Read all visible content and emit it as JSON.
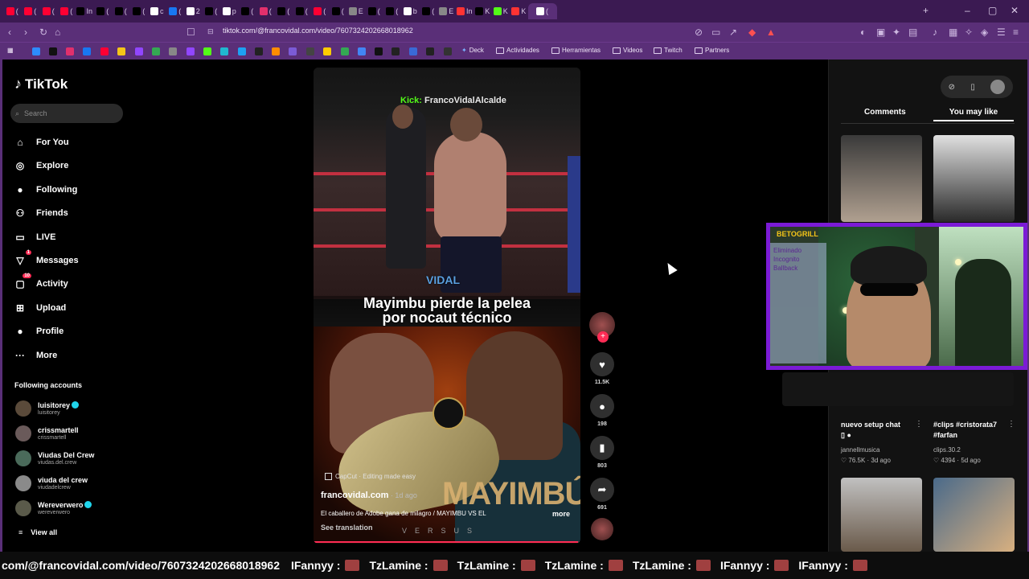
{
  "browser": {
    "tabs": [
      {
        "icon": "youtube-icon",
        "color": "#ff0033",
        "text": "("
      },
      {
        "icon": "youtube-icon",
        "color": "#ff0033",
        "text": "("
      },
      {
        "icon": "youtube-icon",
        "color": "#ff0033",
        "text": "("
      },
      {
        "icon": "youtube-icon",
        "color": "#ff0033",
        "text": "("
      },
      {
        "icon": "x-icon",
        "color": "#000000",
        "text": "In"
      },
      {
        "icon": "x-icon",
        "color": "#000000",
        "text": "("
      },
      {
        "icon": "x-icon",
        "color": "#000000",
        "text": "("
      },
      {
        "icon": "x-icon",
        "color": "#000000",
        "text": "("
      },
      {
        "icon": "generic-icon",
        "color": "#ffffff",
        "text": "c"
      },
      {
        "icon": "facebook-icon",
        "color": "#1877f2",
        "text": "("
      },
      {
        "icon": "generic-icon",
        "color": "#ffffff",
        "text": "2"
      },
      {
        "icon": "tiktok-icon",
        "color": "#000000",
        "text": "("
      },
      {
        "icon": "generic-icon",
        "color": "#ffffff",
        "text": "p"
      },
      {
        "icon": "tiktok-icon",
        "color": "#000000",
        "text": "("
      },
      {
        "icon": "instagram-icon",
        "color": "#e1306c",
        "text": "("
      },
      {
        "icon": "tiktok-icon",
        "color": "#000000",
        "text": "("
      },
      {
        "icon": "tiktok-icon",
        "color": "#000000",
        "text": "("
      },
      {
        "icon": "youtube-icon",
        "color": "#ff0033",
        "text": "("
      },
      {
        "icon": "tiktok-icon",
        "color": "#000000",
        "text": "("
      },
      {
        "icon": "generic-icon",
        "color": "#888888",
        "text": "E"
      },
      {
        "icon": "tiktok-icon",
        "color": "#000000",
        "text": "("
      },
      {
        "icon": "tiktok-icon",
        "color": "#000000",
        "text": "("
      },
      {
        "icon": "generic-icon",
        "color": "#ffffff",
        "text": "b"
      },
      {
        "icon": "tiktok-icon",
        "color": "#000000",
        "text": "("
      },
      {
        "icon": "generic-icon",
        "color": "#888888",
        "text": "E"
      },
      {
        "icon": "generic-icon",
        "color": "#ff3333",
        "text": "In"
      },
      {
        "icon": "tiktok-icon",
        "color": "#000000",
        "text": "K"
      },
      {
        "icon": "kick-icon",
        "color": "#53fc18",
        "text": "K"
      },
      {
        "icon": "generic-icon",
        "color": "#ff3333",
        "text": "K"
      },
      {
        "icon": "generic-icon",
        "color": "#ffffff",
        "text": "("
      }
    ],
    "url": "tiktok.com/@francovidal.com/video/7607324202668018962",
    "bookmarks": {
      "deck": "Deck",
      "folders": [
        "Actividades",
        "Herramientas",
        "Videos",
        "Twitch",
        "Partners"
      ]
    }
  },
  "sidebar": {
    "logo": "TikTok",
    "search_placeholder": "Search",
    "nav": [
      {
        "label": "For You",
        "icon": "home-icon",
        "glyph": "⌂"
      },
      {
        "label": "Explore",
        "icon": "compass-icon",
        "glyph": "◎"
      },
      {
        "label": "Following",
        "icon": "following-avatar-icon",
        "glyph": "●"
      },
      {
        "label": "Friends",
        "icon": "friends-icon",
        "glyph": "⚇"
      },
      {
        "label": "LIVE",
        "icon": "live-icon",
        "glyph": "▭"
      },
      {
        "label": "Messages",
        "icon": "messages-icon",
        "glyph": "▽",
        "badge": "1"
      },
      {
        "label": "Activity",
        "icon": "activity-icon",
        "glyph": "▢",
        "badge": "10"
      },
      {
        "label": "Upload",
        "icon": "upload-icon",
        "glyph": "⊞"
      },
      {
        "label": "Profile",
        "icon": "profile-avatar-icon",
        "glyph": "●"
      },
      {
        "label": "More",
        "icon": "more-icon",
        "glyph": "···"
      }
    ],
    "following_title": "Following accounts",
    "accounts": [
      {
        "name": "luisitorey",
        "handle": "luisitorey",
        "verified": true
      },
      {
        "name": "crissmartell",
        "handle": "crissmartell",
        "verified": false
      },
      {
        "name": "Viudas Del Crew",
        "handle": "viudas.del.crew",
        "verified": false
      },
      {
        "name": "viuda del crew",
        "handle": "viudadelcrew",
        "verified": false
      },
      {
        "name": "Wereverwero",
        "handle": "wereverwero",
        "verified": true
      }
    ],
    "view_all": "View all"
  },
  "video": {
    "watermark_prefix": "Kick:",
    "watermark_name": "FrancoVidalAlcalde",
    "logo_overlay": "VIDAL",
    "headline_1": "Mayimbu pierde la pelea",
    "headline_2": "por nocaut técnico",
    "poster_title": "MAYIMBÚ",
    "poster_sub": "VERSUS",
    "capcut": "CapCut · Editing made easy",
    "author": "francovidal.com",
    "posted": " · 1d ago",
    "description": "El caballero de Adobe gana de milagro / MAYIMBU VS EL",
    "more": "more",
    "see_translation": "See translation",
    "progress": 0.99
  },
  "actions": {
    "likes": "11.5K",
    "comments": "198",
    "saves": "803",
    "shares": "691"
  },
  "right_panel": {
    "tab_comments": "Comments",
    "tab_you_may_like": "You may like",
    "items": [
      {
        "title": "nuevo setup chat",
        "user": "jannellmusica",
        "likes": "76.5K",
        "age": "3d ago"
      },
      {
        "title": "#clips #cristorata7 #farfan",
        "user": "clips.30.2",
        "likes": "4394",
        "age": "5d ago"
      }
    ]
  },
  "stream": {
    "cam_brand": "BETOGRILL",
    "wall_text": "Eliminado Incognito Ballback",
    "ticker": [
      {
        "user": "IFannyy :"
      },
      {
        "user": "TzLamine :"
      },
      {
        "user": "TzLamine :"
      },
      {
        "user": "TzLamine :"
      },
      {
        "user": "TzLamine :"
      },
      {
        "user": "IFannyy :"
      },
      {
        "user": "IFannyy :"
      }
    ],
    "ticker_url": "com/@francovidal.com/video/7607324202668018962"
  }
}
